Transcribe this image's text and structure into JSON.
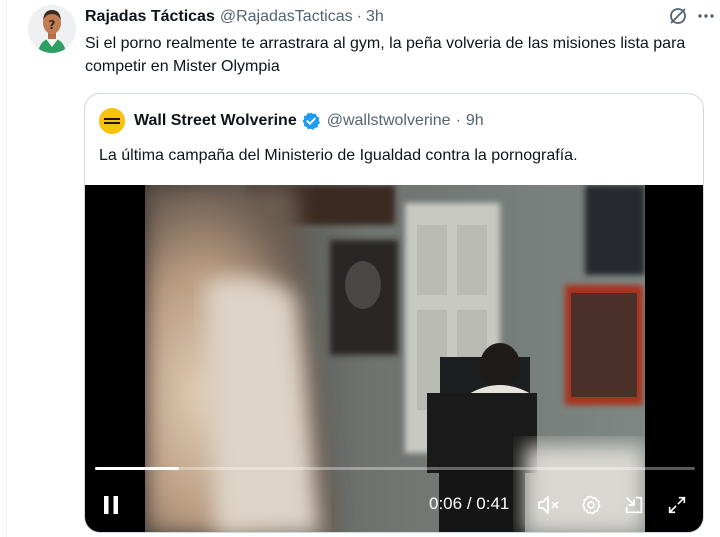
{
  "tweet": {
    "author_name": "Rajadas Tácticas",
    "author_handle": "@RajadasTacticas",
    "separator": "·",
    "time": "3h",
    "text": "Si el porno realmente te arrastrara al gym, la peña volveria de las misiones lista para competir en Mister Olympia"
  },
  "icons": {
    "avatar": "avatar-cartoon",
    "grok": "grok-icon",
    "more": "more-icon"
  },
  "quote": {
    "author_name": "Wall Street Wolverine",
    "author_handle": "@wallstwolverine",
    "separator": "·",
    "time": "9h",
    "verified": true,
    "text": "La última campaña del Ministerio de Igualdad contra la pornografía.",
    "avatar_color": "#f7c20a"
  },
  "video": {
    "time_current": "0:06",
    "time_separator": "/",
    "time_total": "0:41",
    "progress_fraction": 0.14,
    "state": "playing",
    "controls": [
      "pause-icon",
      "mute-icon",
      "settings-icon",
      "pip-icon",
      "fullscreen-icon"
    ]
  },
  "colors": {
    "verified_blue": "#1d9bf0",
    "secondary_text": "#536471",
    "border": "#cfd9de"
  }
}
